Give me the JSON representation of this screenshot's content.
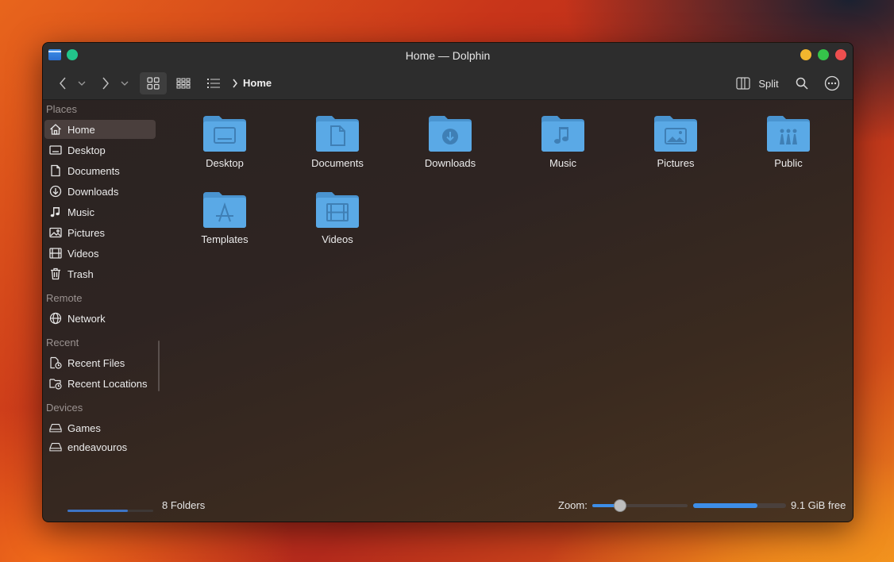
{
  "window": {
    "title": "Home — Dolphin"
  },
  "toolbar": {
    "breadcrumb": "Home",
    "split_label": "Split"
  },
  "sidebar": {
    "places_header": "Places",
    "places": [
      {
        "label": "Home",
        "icon": "home-icon"
      },
      {
        "label": "Desktop",
        "icon": "desktop-icon"
      },
      {
        "label": "Documents",
        "icon": "document-icon"
      },
      {
        "label": "Downloads",
        "icon": "download-icon"
      },
      {
        "label": "Music",
        "icon": "music-icon"
      },
      {
        "label": "Pictures",
        "icon": "picture-icon"
      },
      {
        "label": "Videos",
        "icon": "video-icon"
      },
      {
        "label": "Trash",
        "icon": "trash-icon"
      }
    ],
    "remote_header": "Remote",
    "remote": [
      {
        "label": "Network",
        "icon": "network-icon"
      }
    ],
    "recent_header": "Recent",
    "recent": [
      {
        "label": "Recent Files",
        "icon": "recent-files-icon"
      },
      {
        "label": "Recent Locations",
        "icon": "recent-locations-icon"
      }
    ],
    "devices_header": "Devices",
    "devices": [
      {
        "label": "Games",
        "icon": "drive-icon"
      },
      {
        "label": "endeavouros",
        "icon": "drive-icon"
      }
    ],
    "endeavouros_usage": 0.7
  },
  "folders": [
    {
      "label": "Desktop",
      "icon": "desktop-folder-icon"
    },
    {
      "label": "Documents",
      "icon": "documents-folder-icon"
    },
    {
      "label": "Downloads",
      "icon": "downloads-folder-icon"
    },
    {
      "label": "Music",
      "icon": "music-folder-icon"
    },
    {
      "label": "Pictures",
      "icon": "pictures-folder-icon"
    },
    {
      "label": "Public",
      "icon": "public-folder-icon"
    },
    {
      "label": "Templates",
      "icon": "templates-folder-icon"
    },
    {
      "label": "Videos",
      "icon": "videos-folder-icon"
    }
  ],
  "status": {
    "count": "8 Folders",
    "zoom_label": "Zoom:",
    "zoom_level": 0.29,
    "free_space": "9.1 GiB free",
    "used_fraction": 0.69
  },
  "colors": {
    "accent": "#3d8ee8",
    "folder": "#5aa9e6"
  }
}
